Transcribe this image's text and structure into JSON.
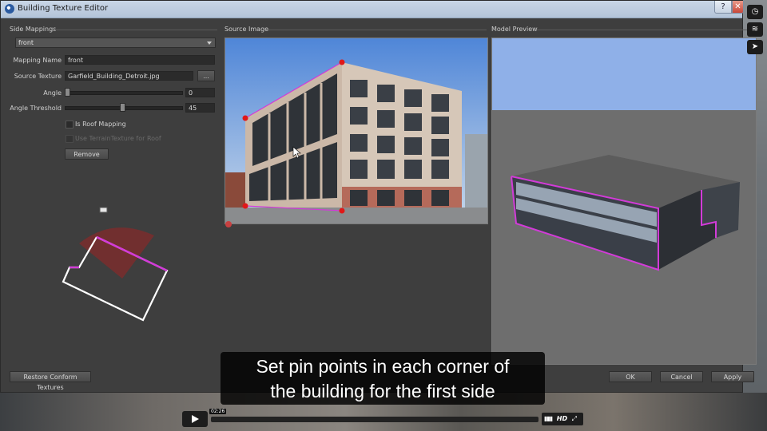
{
  "window": {
    "title": "Building Texture Editor",
    "help_label": "?",
    "close_label": "✕"
  },
  "left": {
    "section_title": "Side Mappings",
    "side_dropdown": "front",
    "mapping_name_label": "Mapping Name",
    "mapping_name_value": "front",
    "source_texture_label": "Source Texture",
    "source_texture_value": "Garfield_Building_Detroit.jpg",
    "browse_label": "...",
    "angle_label": "Angle",
    "angle_value": "0",
    "angle_threshold_label": "Angle Threshold",
    "angle_threshold_value": "45",
    "roof_mapping_label": "Is Roof Mapping",
    "terrain_label": "Use TerrainTexture for Roof",
    "remove_label": "Remove",
    "restore_label": "Restore Conform Textures"
  },
  "source": {
    "section_title": "Source Image"
  },
  "preview": {
    "section_title": "Model Preview"
  },
  "buttons": {
    "ok": "OK",
    "cancel": "Cancel",
    "apply": "Apply"
  },
  "caption": {
    "line1": "Set pin points in each corner of",
    "line2": "the building for the first side"
  },
  "player": {
    "time": "02:26",
    "hd": "HD",
    "progress": 0.0
  },
  "colors": {
    "accent_magenta": "#d23bd8",
    "pin_red": "#e01818"
  }
}
